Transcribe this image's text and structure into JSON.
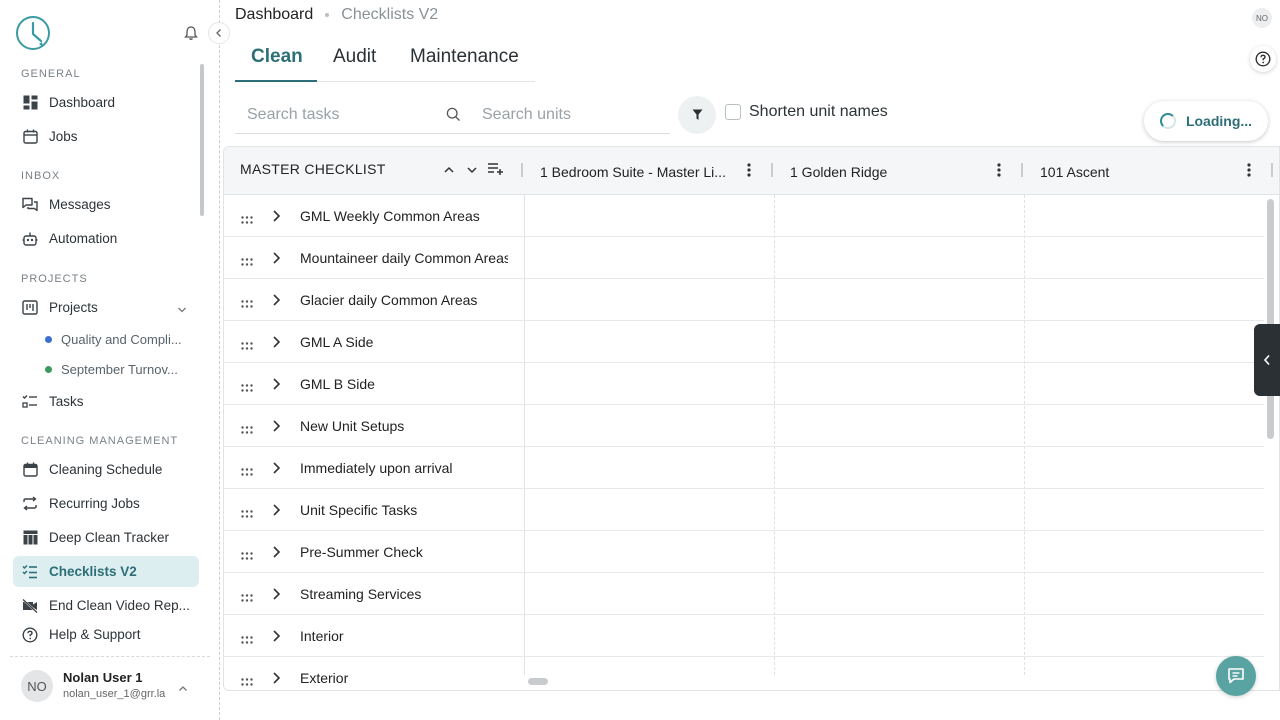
{
  "sidebar": {
    "sections": {
      "general": "GENERAL",
      "inbox": "INBOX",
      "projects": "PROJECTS",
      "cleaning": "CLEANING MANAGEMENT"
    },
    "items": {
      "dashboard": "Dashboard",
      "jobs": "Jobs",
      "messages": "Messages",
      "automation": "Automation",
      "projects": "Projects",
      "project_1": "Quality and Compli...",
      "project_2": "September Turnov...",
      "tasks": "Tasks",
      "cleaning_schedule": "Cleaning Schedule",
      "recurring_jobs": "Recurring Jobs",
      "deep_clean": "Deep Clean Tracker",
      "checklists": "Checklists V2",
      "end_clean": "End Clean Video Rep...",
      "help": "Help & Support"
    },
    "project_colors": [
      "#3b6fd1",
      "#3c9a5f"
    ],
    "user": {
      "initials": "NO",
      "name": "Nolan User 1",
      "email": "nolan_user_1@grr.la"
    }
  },
  "header": {
    "breadcrumb_root": "Dashboard",
    "breadcrumb_current": "Checklists V2",
    "avatar_initials": "NO"
  },
  "tabs": [
    "Clean",
    "Audit",
    "Maintenance"
  ],
  "active_tab": "Clean",
  "filters": {
    "search_tasks_placeholder": "Search tasks",
    "search_units_placeholder": "Search units",
    "shorten_label": "Shorten unit names",
    "shorten_checked": false,
    "loading_label": "Loading..."
  },
  "grid": {
    "master_title": "MASTER CHECKLIST",
    "columns": [
      "1 Bedroom Suite - Master Li...",
      "1 Golden Ridge",
      "101 Ascent"
    ],
    "rows": [
      "GML Weekly Common Areas",
      "Mountaineer daily Common Areas",
      "Glacier daily Common Areas",
      "GML A Side",
      "GML B Side",
      "New Unit Setups",
      "Immediately upon arrival",
      "Unit Specific Tasks",
      "Pre-Summer Check",
      "Streaming Services",
      "Interior",
      "Exterior"
    ]
  },
  "colors": {
    "accent": "#2d6f77",
    "active_bg": "#ddeef0",
    "chat_button": "#5aa3a3"
  }
}
